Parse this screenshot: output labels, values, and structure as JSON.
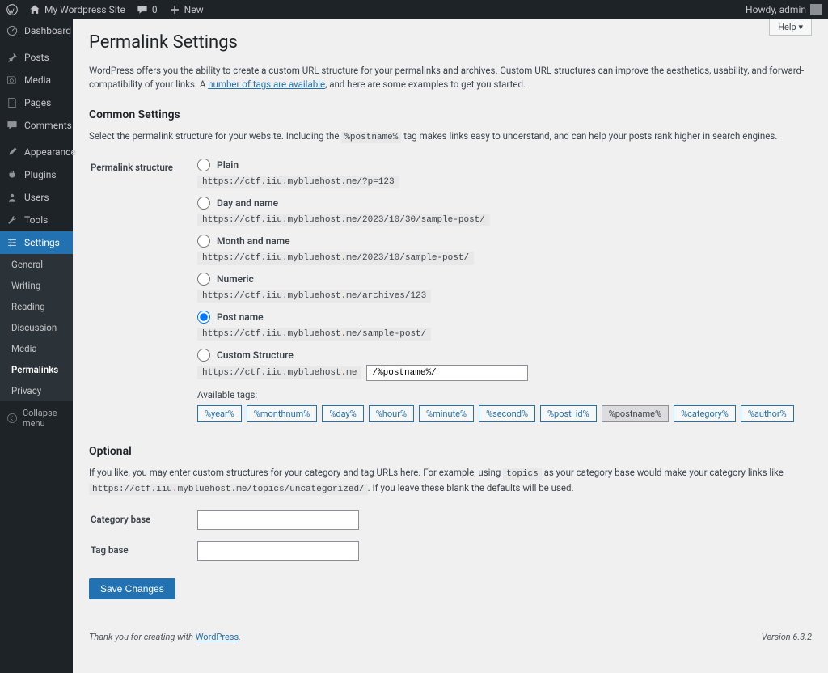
{
  "topbar": {
    "site_name": "My Wordpress Site",
    "comments_count": "0",
    "new_label": "New",
    "howdy": "Howdy, admin"
  },
  "sidebar": {
    "dashboard": "Dashboard",
    "posts": "Posts",
    "media": "Media",
    "pages": "Pages",
    "comments": "Comments",
    "appearance": "Appearance",
    "plugins": "Plugins",
    "users": "Users",
    "tools": "Tools",
    "settings": "Settings",
    "submenu": {
      "general": "General",
      "writing": "Writing",
      "reading": "Reading",
      "discussion": "Discussion",
      "media": "Media",
      "permalinks": "Permalinks",
      "privacy": "Privacy"
    },
    "collapse": "Collapse menu"
  },
  "page": {
    "help": "Help ▾",
    "title": "Permalink Settings",
    "intro_pre": "WordPress offers you the ability to create a custom URL structure for your permalinks and archives. Custom URL structures can improve the aesthetics, usability, and forward-compatibility of your links. A ",
    "intro_link": "number of tags are available",
    "intro_post": ", and here are some examples to get you started.",
    "common_heading": "Common Settings",
    "common_desc_pre": "Select the permalink structure for your website. Including the ",
    "postname_tag": "%postname%",
    "common_desc_post": " tag makes links easy to understand, and can help your posts rank higher in search engines.",
    "structure_label": "Permalink structure",
    "options": {
      "plain": {
        "label": "Plain",
        "url": "https://ctf.iiu.mybluehost.me/?p=123"
      },
      "dayname": {
        "label": "Day and name",
        "url": "https://ctf.iiu.mybluehost.me/2023/10/30/sample-post/"
      },
      "monthname": {
        "label": "Month and name",
        "url": "https://ctf.iiu.mybluehost.me/2023/10/sample-post/"
      },
      "numeric": {
        "label": "Numeric",
        "url": "https://ctf.iiu.mybluehost.me/archives/123"
      },
      "postname": {
        "label": "Post name",
        "url": "https://ctf.iiu.mybluehost.me/sample-post/"
      },
      "custom": {
        "label": "Custom Structure",
        "base": "https://ctf.iiu.mybluehost.me",
        "value": "/%postname%/"
      }
    },
    "available_tags_label": "Available tags:",
    "tags": [
      "%year%",
      "%monthnum%",
      "%day%",
      "%hour%",
      "%minute%",
      "%second%",
      "%post_id%",
      "%postname%",
      "%category%",
      "%author%"
    ],
    "optional_heading": "Optional",
    "optional_desc_pre": "If you like, you may enter custom structures for your category and tag URLs here. For example, using ",
    "optional_topics": "topics",
    "optional_desc_mid": " as your category base would make your category links like ",
    "optional_example": "https://ctf.iiu.mybluehost.me/topics/uncategorized/",
    "optional_desc_post": ". If you leave these blank the defaults will be used.",
    "category_base_label": "Category base",
    "tag_base_label": "Tag base",
    "save": "Save Changes"
  },
  "footer": {
    "thanks_pre": "Thank you for creating with ",
    "wp_link": "WordPress",
    "version": "Version 6.3.2"
  }
}
